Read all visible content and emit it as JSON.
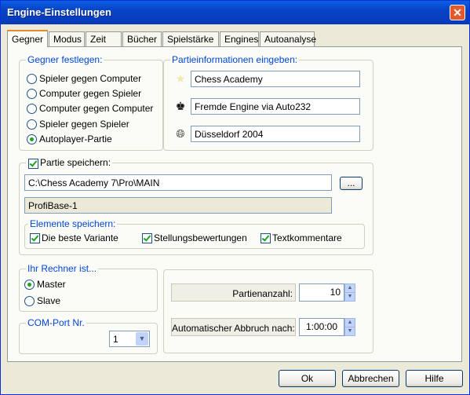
{
  "window": {
    "title": "Engine-Einstellungen",
    "close_glyph": "✕"
  },
  "tabs": [
    {
      "label": "Gegner"
    },
    {
      "label": "Modus"
    },
    {
      "label": "Zeit"
    },
    {
      "label": "Bücher"
    },
    {
      "label": "Spielstärke"
    },
    {
      "label": "Engines"
    },
    {
      "label": "Autoanalyse"
    }
  ],
  "gegner": {
    "label": "Gegner festlegen:",
    "options": [
      {
        "label": "Spieler gegen Computer",
        "selected": false
      },
      {
        "label": "Computer gegen Spieler",
        "selected": false
      },
      {
        "label": "Computer gegen Computer",
        "selected": false
      },
      {
        "label": "Spieler gegen Spieler",
        "selected": false
      },
      {
        "label": "Autoplayer-Partie",
        "selected": true
      }
    ]
  },
  "partieinfo": {
    "label": "Partieinformationen eingeben:",
    "fields": [
      {
        "icon": "star-icon",
        "value": "Chess Academy"
      },
      {
        "icon": "chess-pieces-icon",
        "value": "Fremde Engine via Auto232"
      },
      {
        "icon": "globe-icon",
        "value": "Düsseldorf 2004"
      }
    ]
  },
  "speichern": {
    "label": "Partie speichern:",
    "checked": true,
    "path": "C:\\Chess Academy 7\\Pro\\MAIN",
    "browse_label": "...",
    "database": "ProfiBase-1",
    "elemente": {
      "label": "Elemente speichern:",
      "items": [
        {
          "label": "Die beste Variante",
          "checked": true
        },
        {
          "label": "Stellungsbewertungen",
          "checked": true
        },
        {
          "label": "Textkommentare",
          "checked": true
        }
      ]
    }
  },
  "rechner": {
    "label": "Ihr Rechner ist...",
    "options": [
      {
        "label": "Master",
        "selected": true
      },
      {
        "label": "Slave",
        "selected": false
      }
    ]
  },
  "comport": {
    "label": "COM-Port Nr.",
    "value": "1"
  },
  "match": {
    "partienanzahl_label": "Partienanzahl:",
    "partienanzahl_value": "10",
    "abbruch_label": "Automatischer Abbruch nach:",
    "abbruch_value": "1:00:00"
  },
  "buttons": {
    "ok": "Ok",
    "cancel": "Abbrechen",
    "help": "Hilfe"
  }
}
